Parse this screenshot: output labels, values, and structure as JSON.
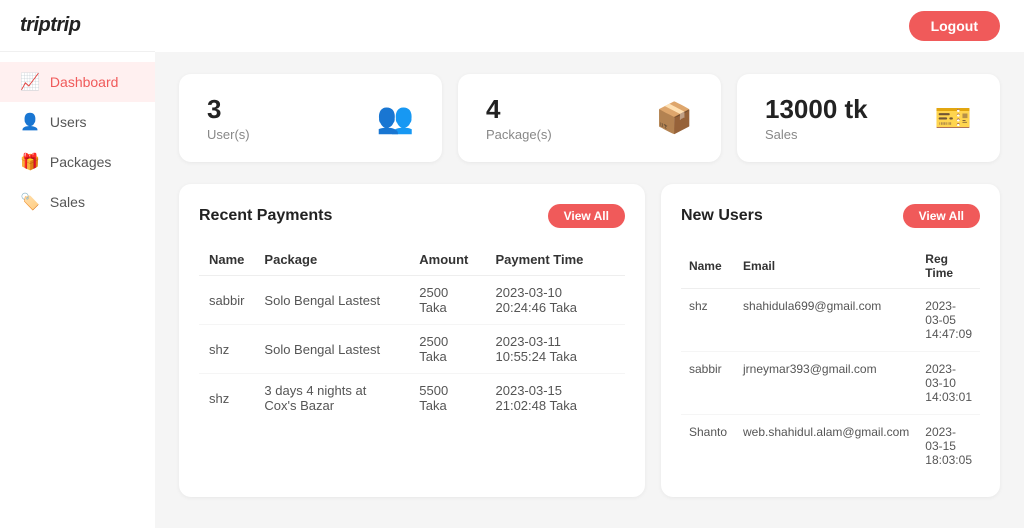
{
  "app": {
    "logo": "triptrip",
    "logout_label": "Logout"
  },
  "sidebar": {
    "items": [
      {
        "id": "dashboard",
        "label": "Dashboard",
        "icon": "📈",
        "active": true
      },
      {
        "id": "users",
        "label": "Users",
        "icon": "👤",
        "active": false
      },
      {
        "id": "packages",
        "label": "Packages",
        "icon": "🎁",
        "active": false
      },
      {
        "id": "sales",
        "label": "Sales",
        "icon": "🏷️",
        "active": false
      }
    ]
  },
  "stats": [
    {
      "id": "users",
      "number": "3",
      "label": "User(s)",
      "icon": "👥"
    },
    {
      "id": "packages",
      "number": "4",
      "label": "Package(s)",
      "icon": "📦"
    },
    {
      "id": "sales",
      "number": "13000 tk",
      "label": "Sales",
      "icon": "🎫"
    }
  ],
  "payments": {
    "title": "Recent Payments",
    "view_all": "View All",
    "columns": [
      "Name",
      "Package",
      "Amount",
      "Payment Time"
    ],
    "rows": [
      {
        "name": "sabbir",
        "package": "Solo Bengal Lastest",
        "amount": "2500 Taka",
        "time": "2023-03-10 20:24:46 Taka"
      },
      {
        "name": "shz",
        "package": "Solo Bengal Lastest",
        "amount": "2500 Taka",
        "time": "2023-03-11 10:55:24 Taka"
      },
      {
        "name": "shz",
        "package": "3 days 4 nights at Cox's Bazar",
        "amount": "5500 Taka",
        "time": "2023-03-15 21:02:48 Taka"
      }
    ]
  },
  "new_users": {
    "title": "New Users",
    "view_all": "View All",
    "columns": [
      "Name",
      "Email",
      "Reg Time"
    ],
    "rows": [
      {
        "name": "shz",
        "email": "shahidula699@gmail.com",
        "reg_time": "2023-03-05 14:47:09"
      },
      {
        "name": "sabbir",
        "email": "jrneymar393@gmail.com",
        "reg_time": "2023-03-10 14:03:01"
      },
      {
        "name": "Shanto",
        "email": "web.shahidul.alam@gmail.com",
        "reg_time": "2023-03-15 18:03:05"
      }
    ]
  }
}
